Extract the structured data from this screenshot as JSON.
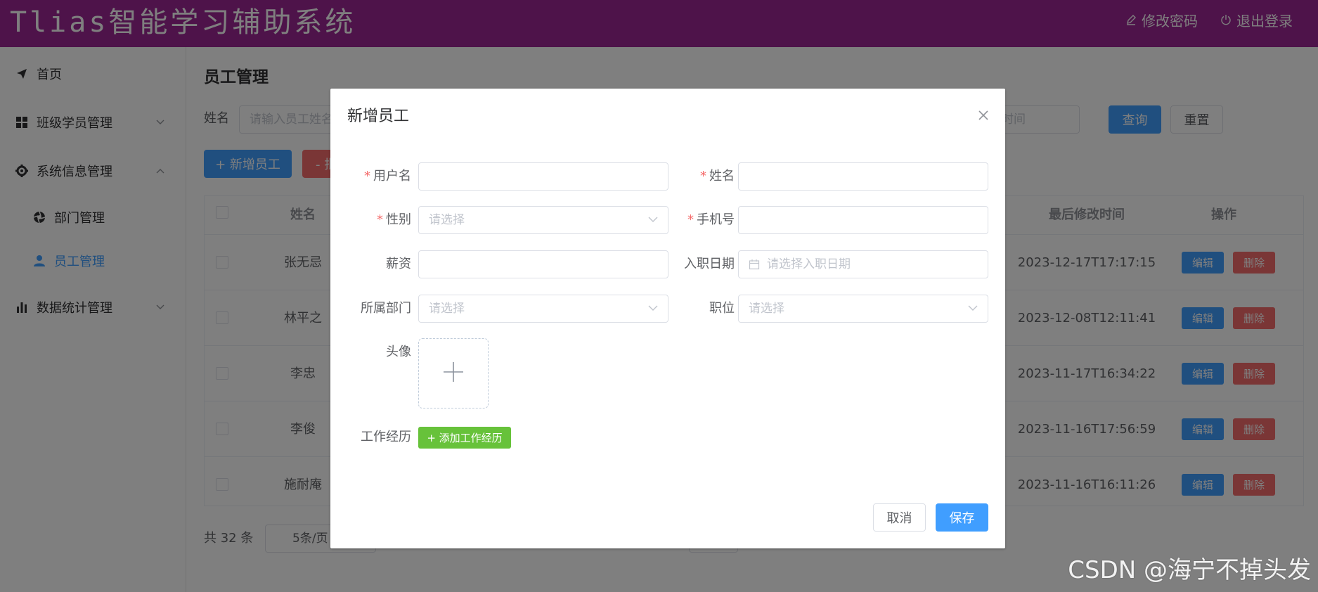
{
  "header": {
    "title": "Tlias智能学习辅助系统",
    "change_password": "修改密码",
    "logout": "退出登录",
    "bg_color": "#9c2794"
  },
  "sidebar": {
    "items": [
      {
        "label": "首页",
        "icon": "send-icon"
      },
      {
        "label": "班级学员管理",
        "icon": "grid-icon"
      },
      {
        "label": "系统信息管理",
        "icon": "gear-icon"
      },
      {
        "label": "部门管理",
        "icon": "aperture-icon"
      },
      {
        "label": "员工管理",
        "icon": "user-icon"
      },
      {
        "label": "数据统计管理",
        "icon": "bar-chart-icon"
      }
    ]
  },
  "main": {
    "page_title": "员工管理",
    "search": {
      "name_label": "姓名",
      "name_placeholder": "请输入员工姓名",
      "date_tail": "时间",
      "query_label": "查询",
      "reset_label": "重置"
    },
    "toolbar": {
      "add_label": "+ 新增员工",
      "batch_delete_label": "- 批"
    },
    "table": {
      "headers": {
        "name": "姓名",
        "update_time": "最后修改时间",
        "actions": "操作"
      },
      "rows": [
        {
          "name": "张无忌",
          "update_time": "2023-12-17T17:17:15"
        },
        {
          "name": "林平之",
          "update_time": "2023-12-08T12:11:41"
        },
        {
          "name": "李忠",
          "update_time": "2023-11-17T16:34:22"
        },
        {
          "name": "李俊",
          "update_time": "2023-11-16T17:56:59"
        },
        {
          "name": "施耐庵",
          "update_time": "2023-11-16T16:11:26"
        }
      ],
      "edit_label": "编辑",
      "delete_label": "删除"
    },
    "pagination": {
      "total": "共 32 条",
      "page_size": "5条/页"
    }
  },
  "dialog": {
    "title": "新增员工",
    "fields": {
      "username_label": "用户名",
      "name_label": "姓名",
      "gender_label": "性别",
      "gender_placeholder": "请选择",
      "phone_label": "手机号",
      "salary_label": "薪资",
      "entry_date_label": "入职日期",
      "entry_date_placeholder": "请选择入职日期",
      "dept_label": "所属部门",
      "dept_placeholder": "请选择",
      "job_label": "职位",
      "job_placeholder": "请选择",
      "avatar_label": "头像",
      "work_exp_label": "工作经历",
      "add_work_exp_label": "+ 添加工作经历"
    },
    "cancel_label": "取消",
    "save_label": "保存"
  },
  "watermark": "CSDN @海宁不掉头发",
  "colors": {
    "primary": "#409eff",
    "danger": "#f56c6c",
    "success": "#67c23a",
    "required": "#f56c6c"
  }
}
